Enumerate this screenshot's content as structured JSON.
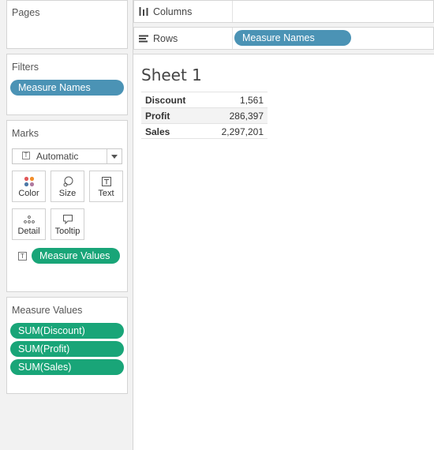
{
  "pages": {
    "title": "Pages"
  },
  "filters": {
    "title": "Filters",
    "pill": "Measure Names"
  },
  "marks": {
    "title": "Marks",
    "mark_type": "Automatic",
    "buttons": {
      "color": "Color",
      "size": "Size",
      "text": "Text",
      "detail": "Detail",
      "tooltip": "Tooltip"
    },
    "text_pill": "Measure Values"
  },
  "measure_values": {
    "title": "Measure Values",
    "items": [
      "SUM(Discount)",
      "SUM(Profit)",
      "SUM(Sales)"
    ]
  },
  "shelves": {
    "columns_label": "Columns",
    "rows_label": "Rows",
    "rows_pill": "Measure Names"
  },
  "view": {
    "title": "Sheet 1",
    "rows": [
      {
        "label": "Discount",
        "value": "1,561"
      },
      {
        "label": "Profit",
        "value": "286,397"
      },
      {
        "label": "Sales",
        "value": "2,297,201"
      }
    ]
  },
  "colors": {
    "dimension_pill": "#4b93b5",
    "measure_pill": "#19a578"
  }
}
